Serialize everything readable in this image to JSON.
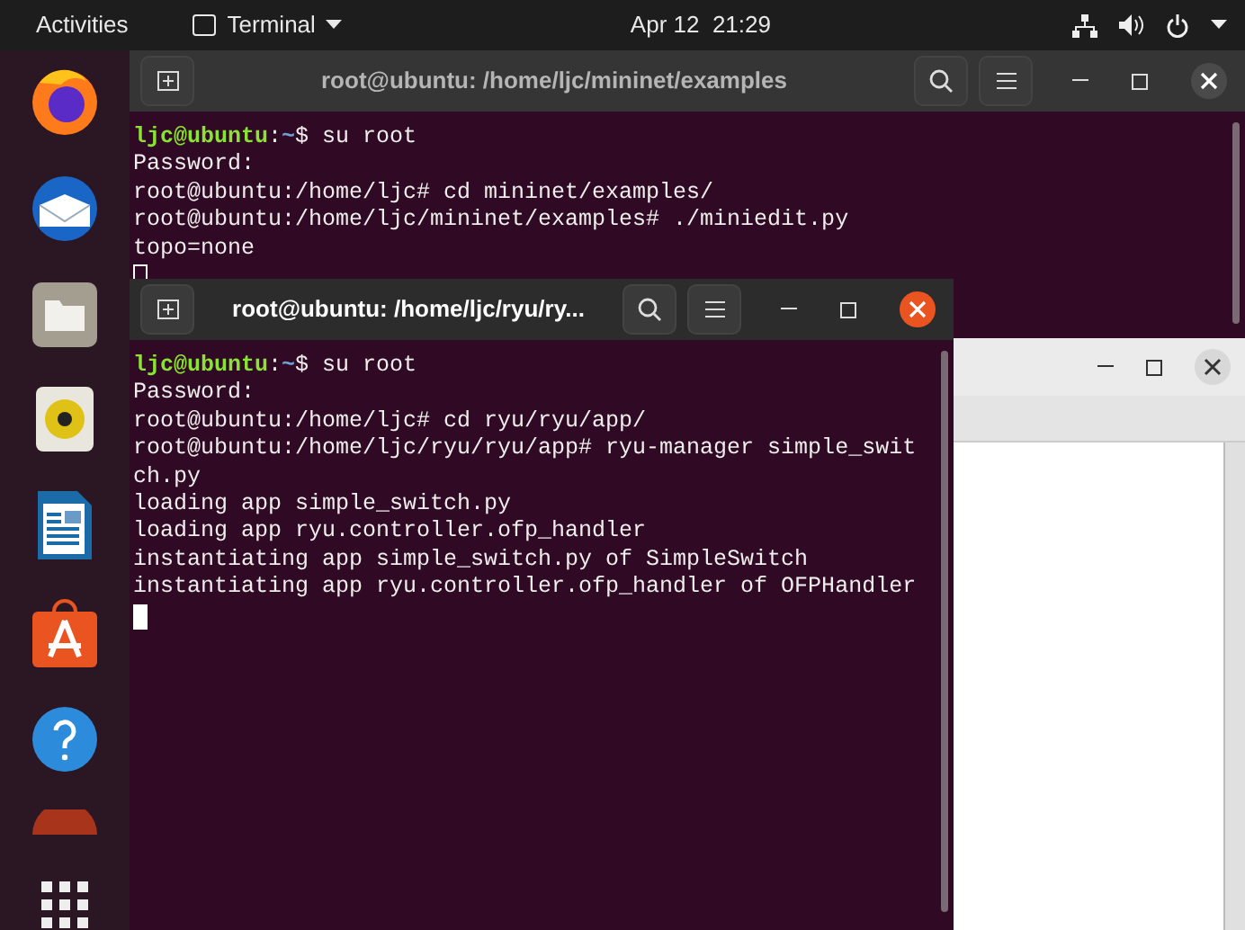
{
  "top_bar": {
    "activities": "Activities",
    "app_menu": "Terminal",
    "clock": "Apr 12  21:29"
  },
  "windows": [
    {
      "title": "root@ubuntu: /home/ljc/mininet/examples",
      "focused": false,
      "lines": [
        {
          "kind": "prompt",
          "user": "ljc@ubuntu",
          "separator": ":",
          "path": "~",
          "command": "$ su root"
        },
        {
          "kind": "text",
          "text": "Password:"
        },
        {
          "kind": "text",
          "text": "root@ubuntu:/home/ljc# cd mininet/examples/"
        },
        {
          "kind": "text",
          "text": "root@ubuntu:/home/ljc/mininet/examples# ./miniedit.py"
        },
        {
          "kind": "text",
          "text": "topo=none"
        }
      ]
    },
    {
      "title": "root@ubuntu: /home/ljc/ryu/ry...",
      "focused": true,
      "lines": [
        {
          "kind": "prompt",
          "user": "ljc@ubuntu",
          "separator": ":",
          "path": "~",
          "command": "$ su root"
        },
        {
          "kind": "text",
          "text": "Password:"
        },
        {
          "kind": "text",
          "text": "root@ubuntu:/home/ljc# cd ryu/ryu/app/"
        },
        {
          "kind": "text",
          "text": "root@ubuntu:/home/ljc/ryu/ryu/app# ryu-manager simple_swit"
        },
        {
          "kind": "text",
          "text": "ch.py"
        },
        {
          "kind": "text",
          "text": "loading app simple_switch.py"
        },
        {
          "kind": "text",
          "text": "loading app ryu.controller.ofp_handler"
        },
        {
          "kind": "text",
          "text": "instantiating app simple_switch.py of SimpleSwitch"
        },
        {
          "kind": "text",
          "text": "instantiating app ryu.controller.ofp_handler of OFPHandler"
        }
      ]
    }
  ]
}
